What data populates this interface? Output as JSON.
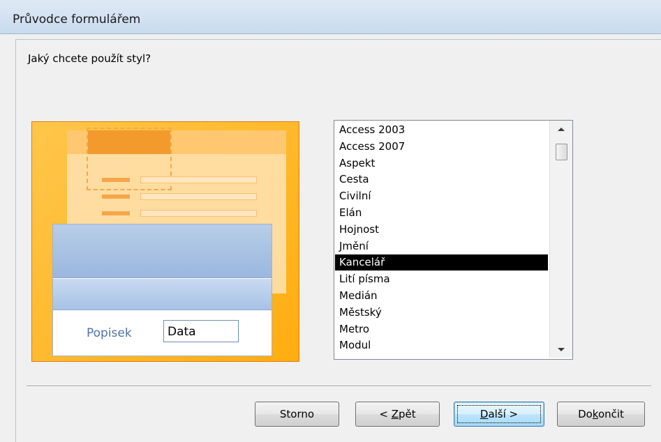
{
  "window": {
    "title": "Průvodce formulářem"
  },
  "prompt": "Jaký chcete použít styl?",
  "preview": {
    "caption": "Popisek",
    "field_value": "Data"
  },
  "style_list": {
    "items": [
      "Access 2003",
      "Access 2007",
      "Aspekt",
      "Cesta",
      "Civilní",
      "Elán",
      "Hojnost",
      "Jmění",
      "Kancelář",
      "Lití písma",
      "Medián",
      "Městský",
      "Metro",
      "Modul"
    ],
    "selected": "Kancelář",
    "scroll_position": 0.16
  },
  "buttons": {
    "cancel": "Storno",
    "back_prefix": "< ",
    "back_mnemonic": "Z",
    "back_rest": "pět",
    "next_mnemonic": "D",
    "next_rest": "alší >",
    "finish_prefix": "Do",
    "finish_mnemonic": "k",
    "finish_rest": "ončit"
  }
}
